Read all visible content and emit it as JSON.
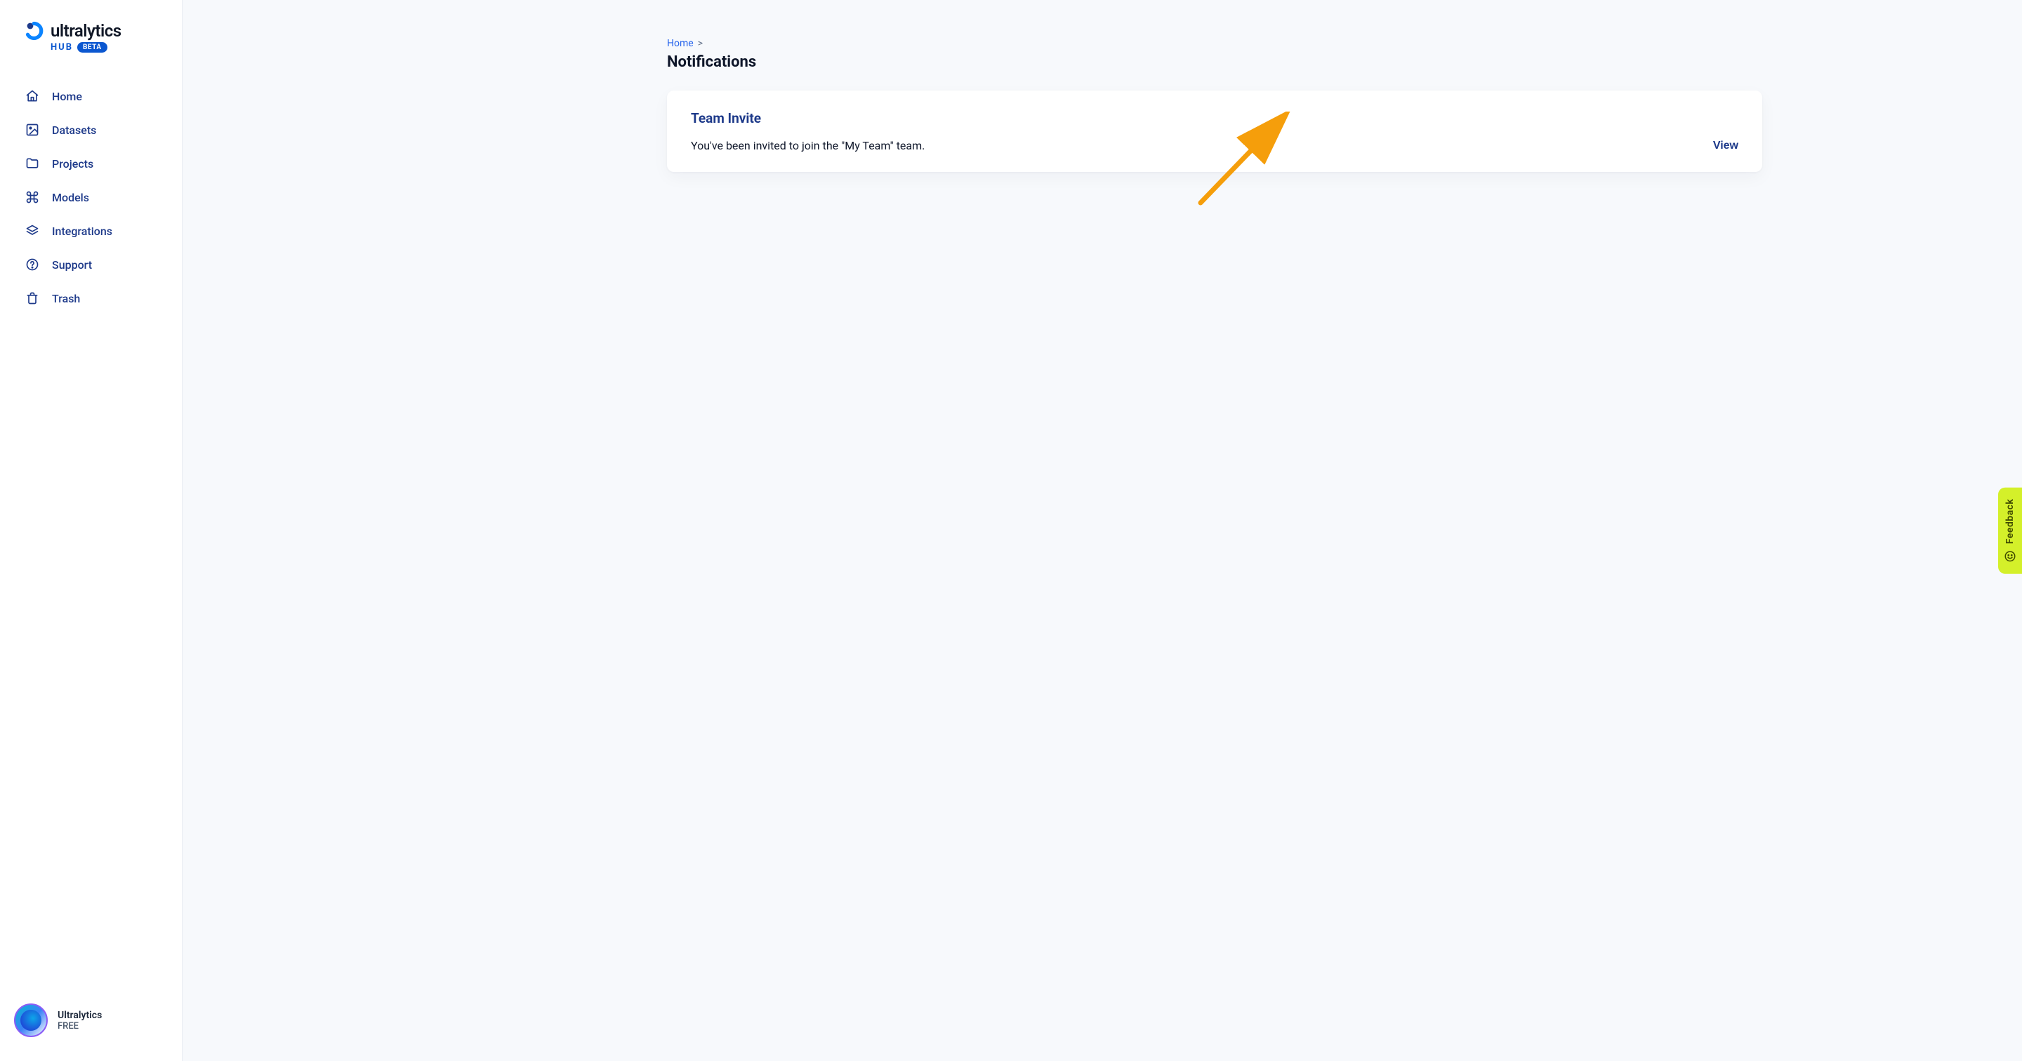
{
  "brand": {
    "name": "ultralytics",
    "hub": "HUB",
    "beta": "BETA"
  },
  "sidebar": {
    "items": [
      {
        "label": "Home"
      },
      {
        "label": "Datasets"
      },
      {
        "label": "Projects"
      },
      {
        "label": "Models"
      },
      {
        "label": "Integrations"
      },
      {
        "label": "Support"
      },
      {
        "label": "Trash"
      }
    ]
  },
  "user": {
    "name": "Ultralytics",
    "plan": "FREE"
  },
  "breadcrumb": {
    "home": "Home",
    "separator": ">"
  },
  "page": {
    "title": "Notifications"
  },
  "notification": {
    "title": "Team Invite",
    "body": "You've been invited to join the \"My Team\" team.",
    "action": "View"
  },
  "feedback": {
    "label": "Feedback"
  }
}
